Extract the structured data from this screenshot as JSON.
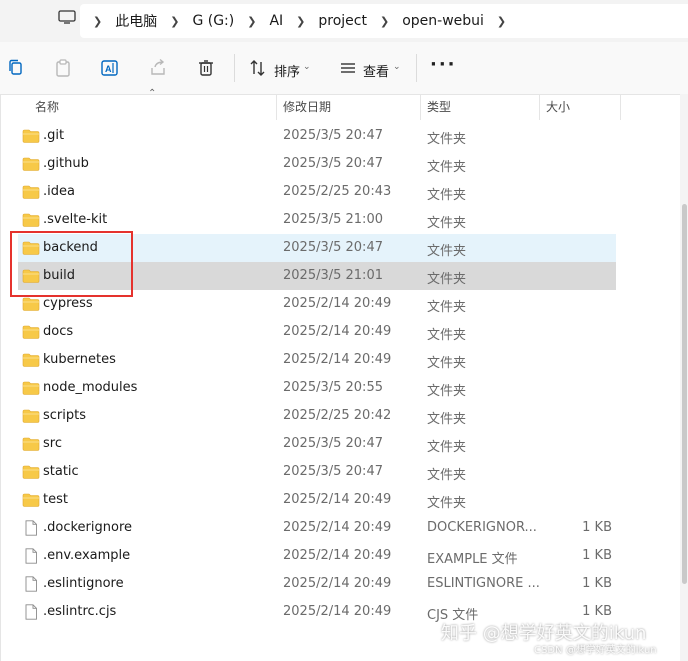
{
  "breadcrumb": [
    "此电脑",
    "G (G:)",
    "AI",
    "project",
    "open-webui"
  ],
  "toolbar": {
    "sort_label": "排序",
    "view_label": "查看",
    "more_label": "···"
  },
  "columns": {
    "name": "名称",
    "date": "修改日期",
    "type": "类型",
    "size": "大小"
  },
  "rows": [
    {
      "name": ".git",
      "date": "2025/3/5 20:47",
      "type": "文件夹",
      "size": "",
      "kind": "folder"
    },
    {
      "name": ".github",
      "date": "2025/3/5 20:47",
      "type": "文件夹",
      "size": "",
      "kind": "folder"
    },
    {
      "name": ".idea",
      "date": "2025/2/25 20:43",
      "type": "文件夹",
      "size": "",
      "kind": "folder"
    },
    {
      "name": ".svelte-kit",
      "date": "2025/3/5 21:00",
      "type": "文件夹",
      "size": "",
      "kind": "folder"
    },
    {
      "name": "backend",
      "date": "2025/3/5 20:47",
      "type": "文件夹",
      "size": "",
      "kind": "folder",
      "state": "hover"
    },
    {
      "name": "build",
      "date": "2025/3/5 21:01",
      "type": "文件夹",
      "size": "",
      "kind": "folder",
      "state": "selected"
    },
    {
      "name": "cypress",
      "date": "2025/2/14 20:49",
      "type": "文件夹",
      "size": "",
      "kind": "folder"
    },
    {
      "name": "docs",
      "date": "2025/2/14 20:49",
      "type": "文件夹",
      "size": "",
      "kind": "folder"
    },
    {
      "name": "kubernetes",
      "date": "2025/2/14 20:49",
      "type": "文件夹",
      "size": "",
      "kind": "folder"
    },
    {
      "name": "node_modules",
      "date": "2025/3/5 20:55",
      "type": "文件夹",
      "size": "",
      "kind": "folder"
    },
    {
      "name": "scripts",
      "date": "2025/2/25 20:42",
      "type": "文件夹",
      "size": "",
      "kind": "folder"
    },
    {
      "name": "src",
      "date": "2025/3/5 20:47",
      "type": "文件夹",
      "size": "",
      "kind": "folder"
    },
    {
      "name": "static",
      "date": "2025/3/5 20:47",
      "type": "文件夹",
      "size": "",
      "kind": "folder"
    },
    {
      "name": "test",
      "date": "2025/2/14 20:49",
      "type": "文件夹",
      "size": "",
      "kind": "folder"
    },
    {
      "name": ".dockerignore",
      "date": "2025/2/14 20:49",
      "type": "DOCKERIGNOR...",
      "size": "1 KB",
      "kind": "file"
    },
    {
      "name": ".env.example",
      "date": "2025/2/14 20:49",
      "type": "EXAMPLE 文件",
      "size": "1 KB",
      "kind": "file"
    },
    {
      "name": ".eslintignore",
      "date": "2025/2/14 20:49",
      "type": "ESLINTIGNORE ...",
      "size": "1 KB",
      "kind": "file"
    },
    {
      "name": ".eslintrc.cjs",
      "date": "2025/2/14 20:49",
      "type": "CJS 文件",
      "size": "1 KB",
      "kind": "file"
    }
  ],
  "watermark": {
    "main": "知乎 @想学好英文的ikun",
    "sub": "CSDN @想学好英文的ikun"
  },
  "colors": {
    "accent": "#0067c0",
    "folder": "#f7c948",
    "highlight": "#e5322d",
    "hover_row": "#e5f3fb",
    "selected_row": "#d9d9d9"
  },
  "icons": {
    "computer": "monitor-icon",
    "copy": "copy-icon",
    "paste": "paste-icon",
    "rename": "rename-icon",
    "share": "share-icon",
    "delete": "trash-icon",
    "sort": "sort-icon",
    "view": "view-icon"
  }
}
